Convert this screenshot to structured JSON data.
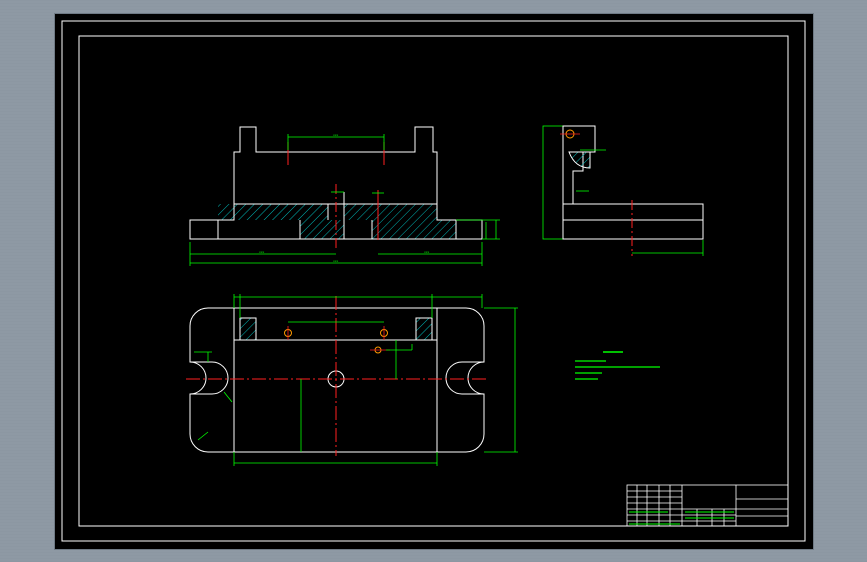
{
  "drawing": {
    "colors": {
      "outline": "#ffffff",
      "dimension": "#00ff00",
      "centerline": "#ff2020",
      "hatch": "#00b8b8",
      "background": "#000000",
      "workspace": "#8e99a4"
    },
    "icons": [
      "hole-icon",
      "slot-icon",
      "title-block-icon"
    ]
  }
}
